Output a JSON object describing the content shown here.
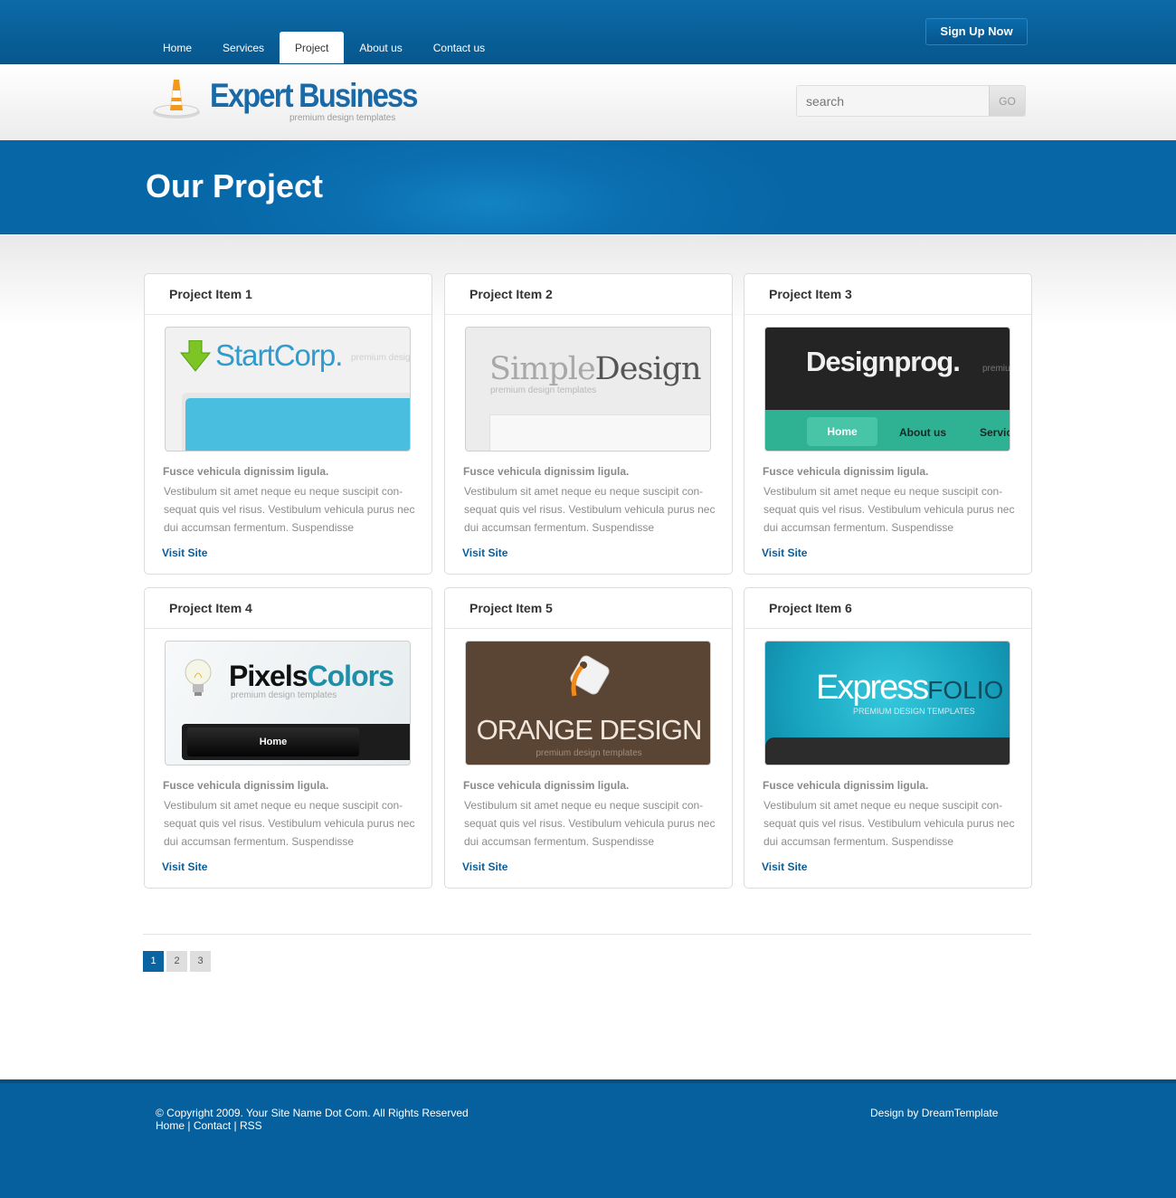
{
  "nav": {
    "items": [
      {
        "label": "Home",
        "active": false
      },
      {
        "label": "Services",
        "active": false
      },
      {
        "label": "Project",
        "active": true
      },
      {
        "label": "About us",
        "active": false
      },
      {
        "label": "Contact us",
        "active": false
      }
    ],
    "signup_label": "Sign Up Now"
  },
  "header": {
    "logo_name": "Expert Business",
    "logo_tagline": "premium design templates",
    "logo_icon": "traffic-cone-icon",
    "search_placeholder": "search",
    "search_button": "GO"
  },
  "banner": {
    "title": "Our Project"
  },
  "projects": [
    {
      "title": "Project Item 1",
      "lead": "Fusce vehicula dignissim ligula.",
      "body": "Vestibulum sit amet neque eu neque suscipit con-sequat quis vel risus. Vestibulum vehicula purus nec dui accumsan fermentum. Suspendisse",
      "link": "Visit Site",
      "thumb": {
        "brand": "StartCorp.",
        "tag": "premium design",
        "icon": "download-arrow-icon"
      }
    },
    {
      "title": "Project Item  2",
      "lead": "Fusce vehicula dignissim ligula.",
      "body": "Vestibulum sit amet neque eu neque suscipit con-sequat quis vel risus. Vestibulum vehicula purus nec dui accumsan fermentum. Suspendisse",
      "link": "Visit Site",
      "thumb": {
        "brand_a": "Simple",
        "brand_b": "Design",
        "tag": "premium design templates"
      }
    },
    {
      "title": "Project Item  3",
      "lead": "Fusce vehicula dignissim ligula.",
      "body": "Vestibulum sit amet neque eu neque suscipit con-sequat quis vel risus. Vestibulum vehicula purus nec dui accumsan fermentum. Suspendisse",
      "link": "Visit Site",
      "thumb": {
        "brand": "Designprog.",
        "tag": "premiu",
        "nav_home": "Home",
        "nav_about": "About us",
        "nav_services": "Servic"
      }
    },
    {
      "title": "Project Item 4",
      "lead": "Fusce vehicula dignissim ligula.",
      "body": "Vestibulum sit amet neque eu neque suscipit con-sequat quis vel risus. Vestibulum vehicula purus nec dui accumsan fermentum. Suspendisse",
      "link": "Visit Site",
      "thumb": {
        "brand_a": "Pixels",
        "brand_b": "Colors",
        "tag": "premium design templates",
        "nav_home": "Home",
        "icon": "lightbulb-icon"
      }
    },
    {
      "title": "Project Item  5",
      "lead": "Fusce vehicula dignissim ligula.",
      "body": "Vestibulum sit amet neque eu neque suscipit con-sequat quis vel risus. Vestibulum vehicula purus nec dui accumsan fermentum. Suspendisse",
      "link": "Visit Site",
      "thumb": {
        "brand": "ORANGE DESIGN",
        "tag": "premium design templates",
        "icon": "price-tag-icon"
      }
    },
    {
      "title": "Project Item  6",
      "lead": "Fusce vehicula dignissim ligula.",
      "body": "Vestibulum sit amet neque eu neque suscipit con-sequat quis vel risus. Vestibulum vehicula purus nec dui accumsan fermentum. Suspendisse",
      "link": "Visit Site",
      "thumb": {
        "brand_a": "Express",
        "brand_b": "FOLIO",
        "tag": "PREMIUM DESIGN TEMPLATES"
      }
    }
  ],
  "pagination": {
    "pages": [
      "1",
      "2",
      "3"
    ],
    "current": "1"
  },
  "footer": {
    "copyright": "© Copyright 2009. Your Site Name Dot Com. All Rights Reserved",
    "links": [
      "Home",
      "Contact",
      "RSS"
    ],
    "separator": " | ",
    "credit": "Design by DreamTemplate"
  },
  "colors": {
    "brand_blue": "#06609e",
    "link_blue": "#0a5d99",
    "active_page": "#0b64a2"
  }
}
